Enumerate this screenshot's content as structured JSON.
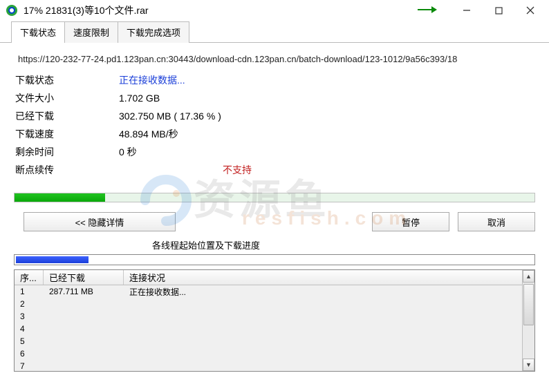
{
  "window": {
    "title": "17% 21831(3)等10个文件.rar"
  },
  "tabs": {
    "t0": "下载状态",
    "t1": "速度限制",
    "t2": "下载完成选项"
  },
  "url": "https://120-232-77-24.pd1.123pan.cn:30443/download-cdn.123pan.cn/batch-download/123-1012/9a56c393/18",
  "status": {
    "label": "下载状态",
    "value": "正在接收数据..."
  },
  "filesize": {
    "label": "文件大小",
    "value": "1.702  GB"
  },
  "downloaded": {
    "label": "已经下载",
    "value": "302.750  MB ( 17.36 % )"
  },
  "speed": {
    "label": "下载速度",
    "value": "48.894  MB/秒"
  },
  "remaining": {
    "label": "剩余时间",
    "value": "0 秒"
  },
  "resume": {
    "label": "断点续传",
    "value": "不支持"
  },
  "buttons": {
    "hide": "<<  隐藏详情",
    "pause": "暂停",
    "cancel": "取消"
  },
  "threads_title": "各线程起始位置及下载进度",
  "table": {
    "h_num": "序...",
    "h_dn": "已经下载",
    "h_st": "连接状况",
    "rows": [
      {
        "n": "1",
        "dn": "287.711  MB",
        "st": "正在接收数据..."
      },
      {
        "n": "2",
        "dn": "",
        "st": ""
      },
      {
        "n": "3",
        "dn": "",
        "st": ""
      },
      {
        "n": "4",
        "dn": "",
        "st": ""
      },
      {
        "n": "5",
        "dn": "",
        "st": ""
      },
      {
        "n": "6",
        "dn": "",
        "st": ""
      },
      {
        "n": "7",
        "dn": "",
        "st": ""
      }
    ]
  },
  "watermark": {
    "main": "资源鱼",
    "sub": "resfish.com"
  }
}
